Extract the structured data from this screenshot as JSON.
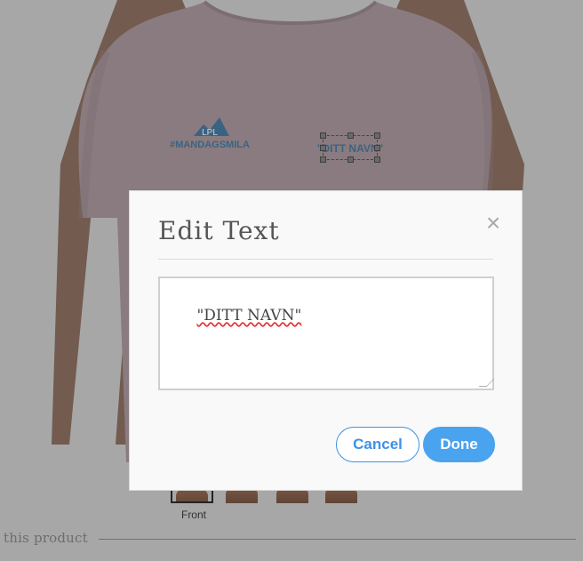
{
  "product": {
    "front_logo": {
      "brand_text": "LPL",
      "hashtag": "#MANDAGSMILA"
    },
    "selected_text": "\"DITT NAVN\""
  },
  "thumbs": [
    {
      "label": "Front"
    },
    {
      "label": ""
    },
    {
      "label": ""
    },
    {
      "label": ""
    }
  ],
  "section": {
    "title": "this product"
  },
  "modal": {
    "title": "Edit Text",
    "close_icon": "×",
    "textarea_value": "\"DITT NAVN\"",
    "cancel_label": "Cancel",
    "done_label": "Done"
  },
  "colors": {
    "shirt": "#8d7c80",
    "skin": "#6b4b3c",
    "logo": "#2d5f86",
    "button_blue": "#49a3ef",
    "overlay_grey": "#b1b1b1"
  }
}
